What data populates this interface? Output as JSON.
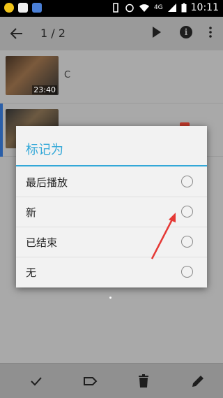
{
  "status_bar": {
    "time": "10:11",
    "network": "4G"
  },
  "toolbar": {
    "page_count": "1 / 2"
  },
  "list": {
    "items": [
      {
        "title": "C",
        "duration": "23:40"
      },
      {
        "title": "",
        "duration": ""
      }
    ]
  },
  "dialog": {
    "title": "标记为",
    "options": [
      {
        "label": "最后播放"
      },
      {
        "label": "新"
      },
      {
        "label": "已结束"
      },
      {
        "label": "无"
      }
    ]
  },
  "colors": {
    "accent": "#33a8d8",
    "annotation_arrow": "#e53935"
  }
}
